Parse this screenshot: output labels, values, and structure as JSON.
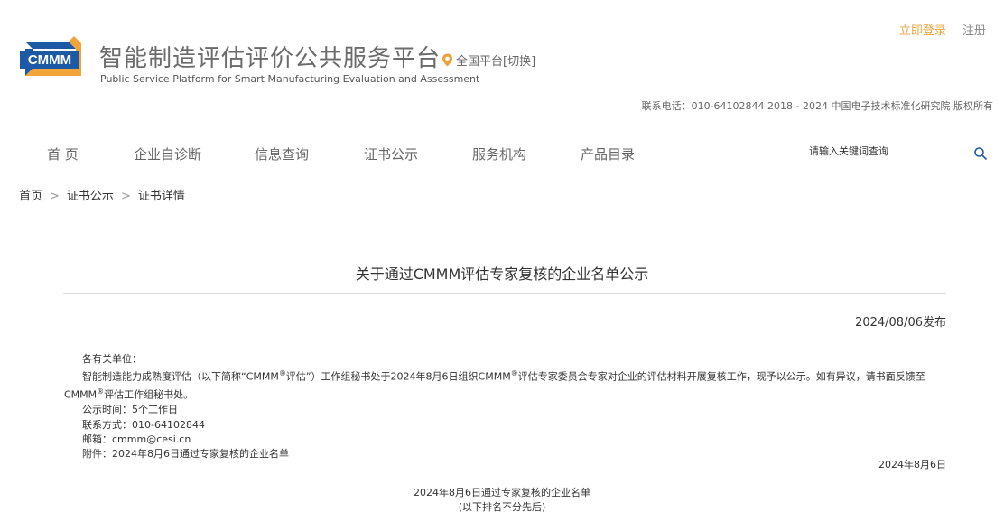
{
  "header": {
    "logo_text": "CMMM",
    "title": "智能制造评估评价公共服务平台",
    "subtitle": "Public Service Platform for Smart Manufacturing Evaluation and Assessment",
    "region": "全国平台[切换]",
    "login": "立即登录",
    "register": "注册",
    "contact": "联系电话：010-64102844  2018 - 2024 中国电子技术标准化研究院 版权所有"
  },
  "nav": {
    "items": [
      "首 页",
      "企业自诊断",
      "信息查询",
      "证书公示",
      "服务机构",
      "产品目录"
    ],
    "search_placeholder": "请输入关键词查询"
  },
  "breadcrumb": [
    "首页",
    "证书公示",
    "证书详情"
  ],
  "breadcrumb_sep": ">",
  "article": {
    "title": "关于通过CMMM评估专家复核的企业名单公示",
    "publish_date": "2024/08/06发布",
    "salutation": "各有关单位：",
    "para1_a": "智能制造能力成熟度评估（以下简称“CMMM",
    "para1_b": "评估”）工作组秘书处于2024年8月6日组织CMMM",
    "para1_c": "评估专家委员会专家对企业的评估材料开展复核工作，现予以公示。如有异议，请书面反馈至",
    "para1_d": "CMMM",
    "para1_e": "评估工作组秘书处。",
    "reg_mark": "®",
    "period": "公示时间：5个工作日",
    "contact": "联系方式：010-64102844",
    "email": "邮箱：cmmm@cesi.cn",
    "attachment": "附件：2024年8月6日通过专家复核的企业名单",
    "sign_date": "2024年8月6日",
    "list_title": "2024年8月6日通过专家复核的企业名单",
    "list_note": "(以下排名不分先后)"
  },
  "colors": {
    "accent": "#e8a33d",
    "logo_blue": "#1c5aa6",
    "logo_orange": "#f2a33a"
  },
  "icons": {
    "region": "location-pin-icon",
    "search": "search-icon"
  }
}
